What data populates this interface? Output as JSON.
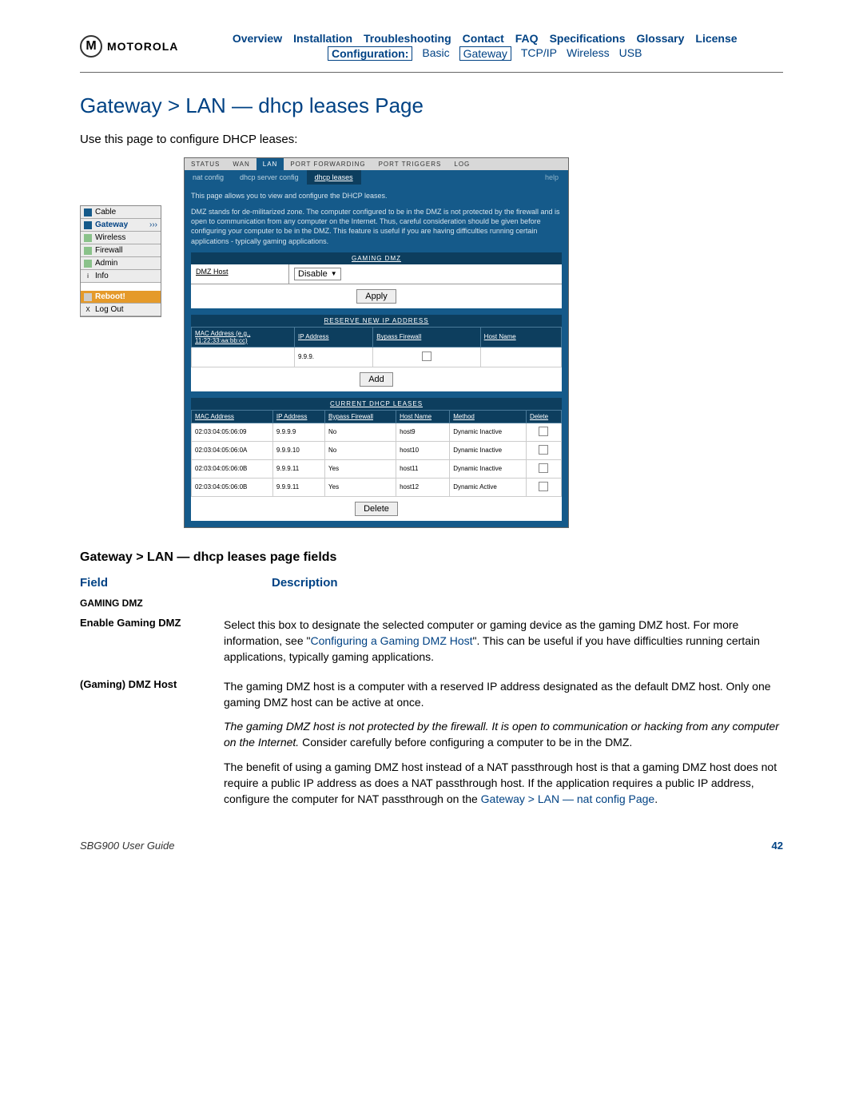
{
  "logo_text": "MOTOROLA",
  "topnav": [
    "Overview",
    "Installation",
    "Troubleshooting",
    "Contact",
    "FAQ",
    "Specifications",
    "Glossary",
    "License"
  ],
  "subnav": {
    "lead": "Configuration:",
    "items": [
      "Basic",
      "Gateway",
      "TCP/IP",
      "Wireless",
      "USB"
    ]
  },
  "page_title": "Gateway > LAN — dhcp leases Page",
  "intro": "Use this page to configure DHCP leases:",
  "sidenav": [
    {
      "label": "Cable",
      "color": "#155a8a"
    },
    {
      "label": "Gateway",
      "color": "#155a8a",
      "sel": true,
      "arrow": "›››"
    },
    {
      "label": "Wireless",
      "color": "#8ac28a"
    },
    {
      "label": "Firewall",
      "color": "#8ac28a"
    },
    {
      "label": "Admin",
      "color": "#8ac28a"
    },
    {
      "label": "Info",
      "color": "#ddd",
      "mark": "i"
    },
    {
      "gap": true
    },
    {
      "label": "Reboot!",
      "reboot": true
    },
    {
      "label": "Log Out",
      "mark": "X"
    }
  ],
  "tabs": [
    "STATUS",
    "WAN",
    "LAN",
    "PORT FORWARDING",
    "PORT TRIGGERS",
    "LOG"
  ],
  "subtabs": [
    "nat config",
    "dhcp server config",
    "dhcp leases"
  ],
  "help": "help",
  "shot_text1": "This page allows you to view and configure the DHCP leases.",
  "shot_text2": "DMZ stands for de-militarized zone. The computer configured to be in the DMZ is not protected by the firewall and is open to communication from any computer on the Internet. Thus, careful consideration should be given before configuring your computer to be in the DMZ. This feature is useful if you are having difficulties running certain applications - typically gaming applications.",
  "gaming_dmz": {
    "title": "GAMING DMZ",
    "row_label": "DMZ Host",
    "select": "Disable",
    "apply": "Apply"
  },
  "reserve": {
    "title": "RESERVE NEW IP ADDRESS",
    "headers": [
      "MAC Address\n(e.g., 11:22:33:aa:bb:cc)",
      "IP Address",
      "Bypass\nFirewall",
      "Host Name"
    ],
    "ip_prefix": "9.9.9.",
    "add": "Add"
  },
  "leases": {
    "title": "CURRENT DHCP LEASES",
    "headers": [
      "MAC Address",
      "IP Address",
      "Bypass\nFirewall",
      "Host Name",
      "Method",
      "Delete"
    ],
    "rows": [
      {
        "mac": "02:03:04:05:06:09",
        "ip": "9.9.9.9",
        "bypass": "No",
        "host": "host9",
        "method": "Dynamic Inactive"
      },
      {
        "mac": "02:03:04:05:06:0A",
        "ip": "9.9.9.10",
        "bypass": "No",
        "host": "host10",
        "method": "Dynamic Inactive"
      },
      {
        "mac": "02:03:04:05:06:0B",
        "ip": "9.9.9.11",
        "bypass": "Yes",
        "host": "host11",
        "method": "Dynamic Inactive"
      },
      {
        "mac": "02:03:04:05:06:0B",
        "ip": "9.9.9.11",
        "bypass": "Yes",
        "host": "host12",
        "method": "Dynamic Active"
      }
    ],
    "delete": "Delete"
  },
  "sub_title": "Gateway > LAN — dhcp leases page fields",
  "col_heads": {
    "c1": "Field",
    "c2": "Description"
  },
  "section_gaming": "GAMING DMZ",
  "fields": [
    {
      "name": "Enable Gaming DMZ",
      "desc_pre": "Select this box to designate the selected computer or gaming device as the gaming DMZ host. For more information, see \"",
      "desc_link": "Configuring a Gaming DMZ Host",
      "desc_post": "\". This can be useful if you have difficulties running certain applications, typically gaming applications."
    },
    {
      "name": "(Gaming) DMZ Host",
      "desc_p1": "The gaming DMZ host is a computer with a reserved IP address designated as the default DMZ host. Only one gaming DMZ host can be active at once.",
      "desc_italic": "The gaming DMZ host is not protected by the firewall. It is open to communication or hacking from any computer on the Internet.",
      "desc_p2": " Consider carefully before configuring a computer to be in the DMZ.",
      "desc_p3": "The benefit of using a gaming DMZ host instead of a NAT passthrough host is that a gaming DMZ host does not require a public IP address as does a NAT passthrough host. If the application requires a public IP address, configure the computer for NAT passthrough on the ",
      "desc_link2": "Gateway > LAN — nat config Page",
      "desc_p4": "."
    }
  ],
  "footer": {
    "left": "SBG900 User Guide",
    "right": "42"
  }
}
